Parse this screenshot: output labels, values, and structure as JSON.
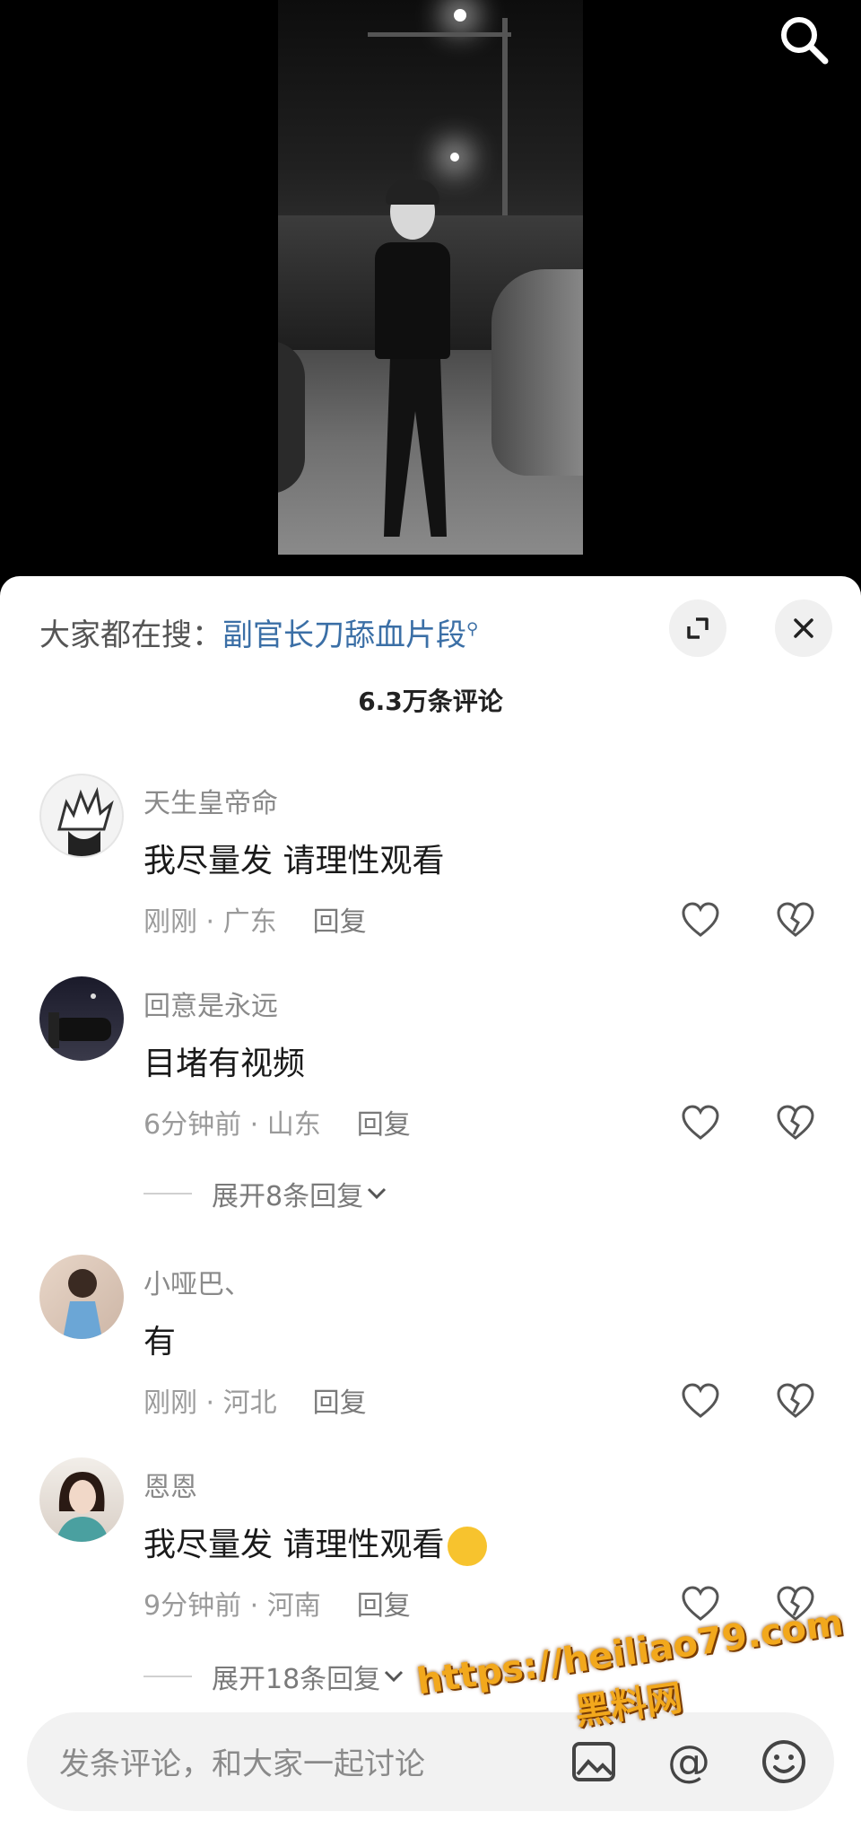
{
  "hot_search": {
    "prefix": "大家都在搜：",
    "query": "副官长刀舔血片段"
  },
  "comment_count": "6.3万条评论",
  "comments": [
    {
      "name": "天生皇帝命",
      "text": "我尽量发 请理性观看",
      "meta": "刚刚 · 广东",
      "reply": "回复"
    },
    {
      "name": "回意是永远",
      "text": "目堵有视频",
      "meta": "6分钟前 · 山东",
      "reply": "回复",
      "expand": "展开8条回复"
    },
    {
      "name": "小哑巴、",
      "text": "有",
      "meta": "刚刚 · 河北",
      "reply": "回复"
    },
    {
      "name": "恩恩",
      "text": "我尽量发  请理性观看",
      "meta": "9分钟前 · 河南",
      "reply": "回复",
      "expand": "展开18条回复"
    }
  ],
  "input": {
    "placeholder": "发条评论，和大家一起讨论",
    "at_symbol": "@"
  },
  "watermark": {
    "line1": "https://heiliao79.com",
    "line2": "黑料网"
  },
  "icons": {
    "search": "search-icon",
    "expand": "expand-icon",
    "close": "close-icon",
    "heart": "heart-icon",
    "broken_heart": "broken-heart-icon",
    "image": "image-icon",
    "at": "at-icon",
    "emoji": "emoji-icon",
    "chevron": "chevron-down-icon"
  },
  "colors": {
    "link": "#3b6fa6",
    "watermark": "#f2a81c"
  }
}
